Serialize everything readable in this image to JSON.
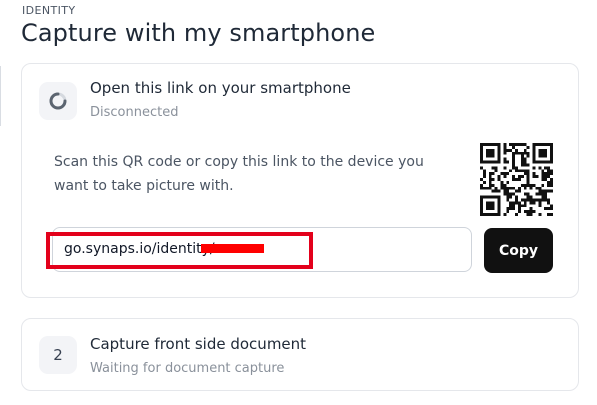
{
  "header": {
    "eyebrow": "IDENTITY",
    "title": "Capture with my smartphone"
  },
  "steps": [
    {
      "icon": "loading-spinner-icon",
      "title": "Open this link on your smartphone",
      "status": "Disconnected",
      "instructions": "Scan this QR code or copy this link to the device you want to take picture with.",
      "qr_icon": "qr-code-icon",
      "link": {
        "value": "go.synaps.io/identity/",
        "redacted": true
      },
      "copy_label": "Copy"
    },
    {
      "number": "2",
      "title": "Capture front side document",
      "status": "Waiting for document capture"
    }
  ],
  "colors": {
    "accent_black": "#111111",
    "redaction_red": "#ff0000",
    "highlight_red": "#e3001b",
    "card_border": "#e5e7eb",
    "muted_text": "#8a919b"
  }
}
